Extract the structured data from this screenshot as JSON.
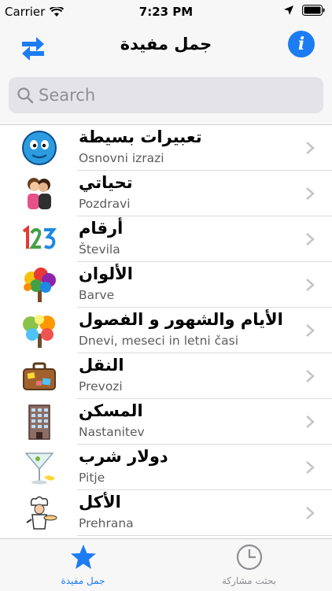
{
  "status_bar": {
    "carrier": "Carrier",
    "time": "7:23 PM"
  },
  "nav": {
    "title": "جمل مفيدة",
    "swap_icon": "swap-arrows-icon",
    "info_icon": "info-icon",
    "info_glyph": "i",
    "accent_color": "#1c7cf2"
  },
  "search": {
    "placeholder": "Search"
  },
  "list": {
    "items": [
      {
        "title": "تعبيرات بسيطة",
        "subtitle": "Osnovni izrazi",
        "icon": "smiley-face-icon"
      },
      {
        "title": "تحياتي",
        "subtitle": "Pozdravi",
        "icon": "hugging-people-icon"
      },
      {
        "title": "أرقام",
        "subtitle": "Števila",
        "icon": "numbers-123-icon"
      },
      {
        "title": "الألوان",
        "subtitle": "Barve",
        "icon": "colorful-tree-icon"
      },
      {
        "title": "الأيام والشهور و الفصول",
        "subtitle": "Dnevi, meseci in letni časi",
        "icon": "seasons-tree-icon"
      },
      {
        "title": "النقل",
        "subtitle": "Prevozi",
        "icon": "suitcase-icon"
      },
      {
        "title": "المسكن",
        "subtitle": "Nastanitev",
        "icon": "building-icon"
      },
      {
        "title": "دولار شرب",
        "subtitle": "Pitje",
        "icon": "cocktail-glass-icon"
      },
      {
        "title": "الأكل",
        "subtitle": "Prehrana",
        "icon": "chef-icon"
      }
    ]
  },
  "tabs": [
    {
      "label": "جمل مفيدة",
      "icon": "star-icon",
      "active": true,
      "color": "#1c7cf2"
    },
    {
      "label": "بحثت مشاركة",
      "icon": "clock-icon",
      "active": false,
      "color": "#8e8e93"
    }
  ]
}
